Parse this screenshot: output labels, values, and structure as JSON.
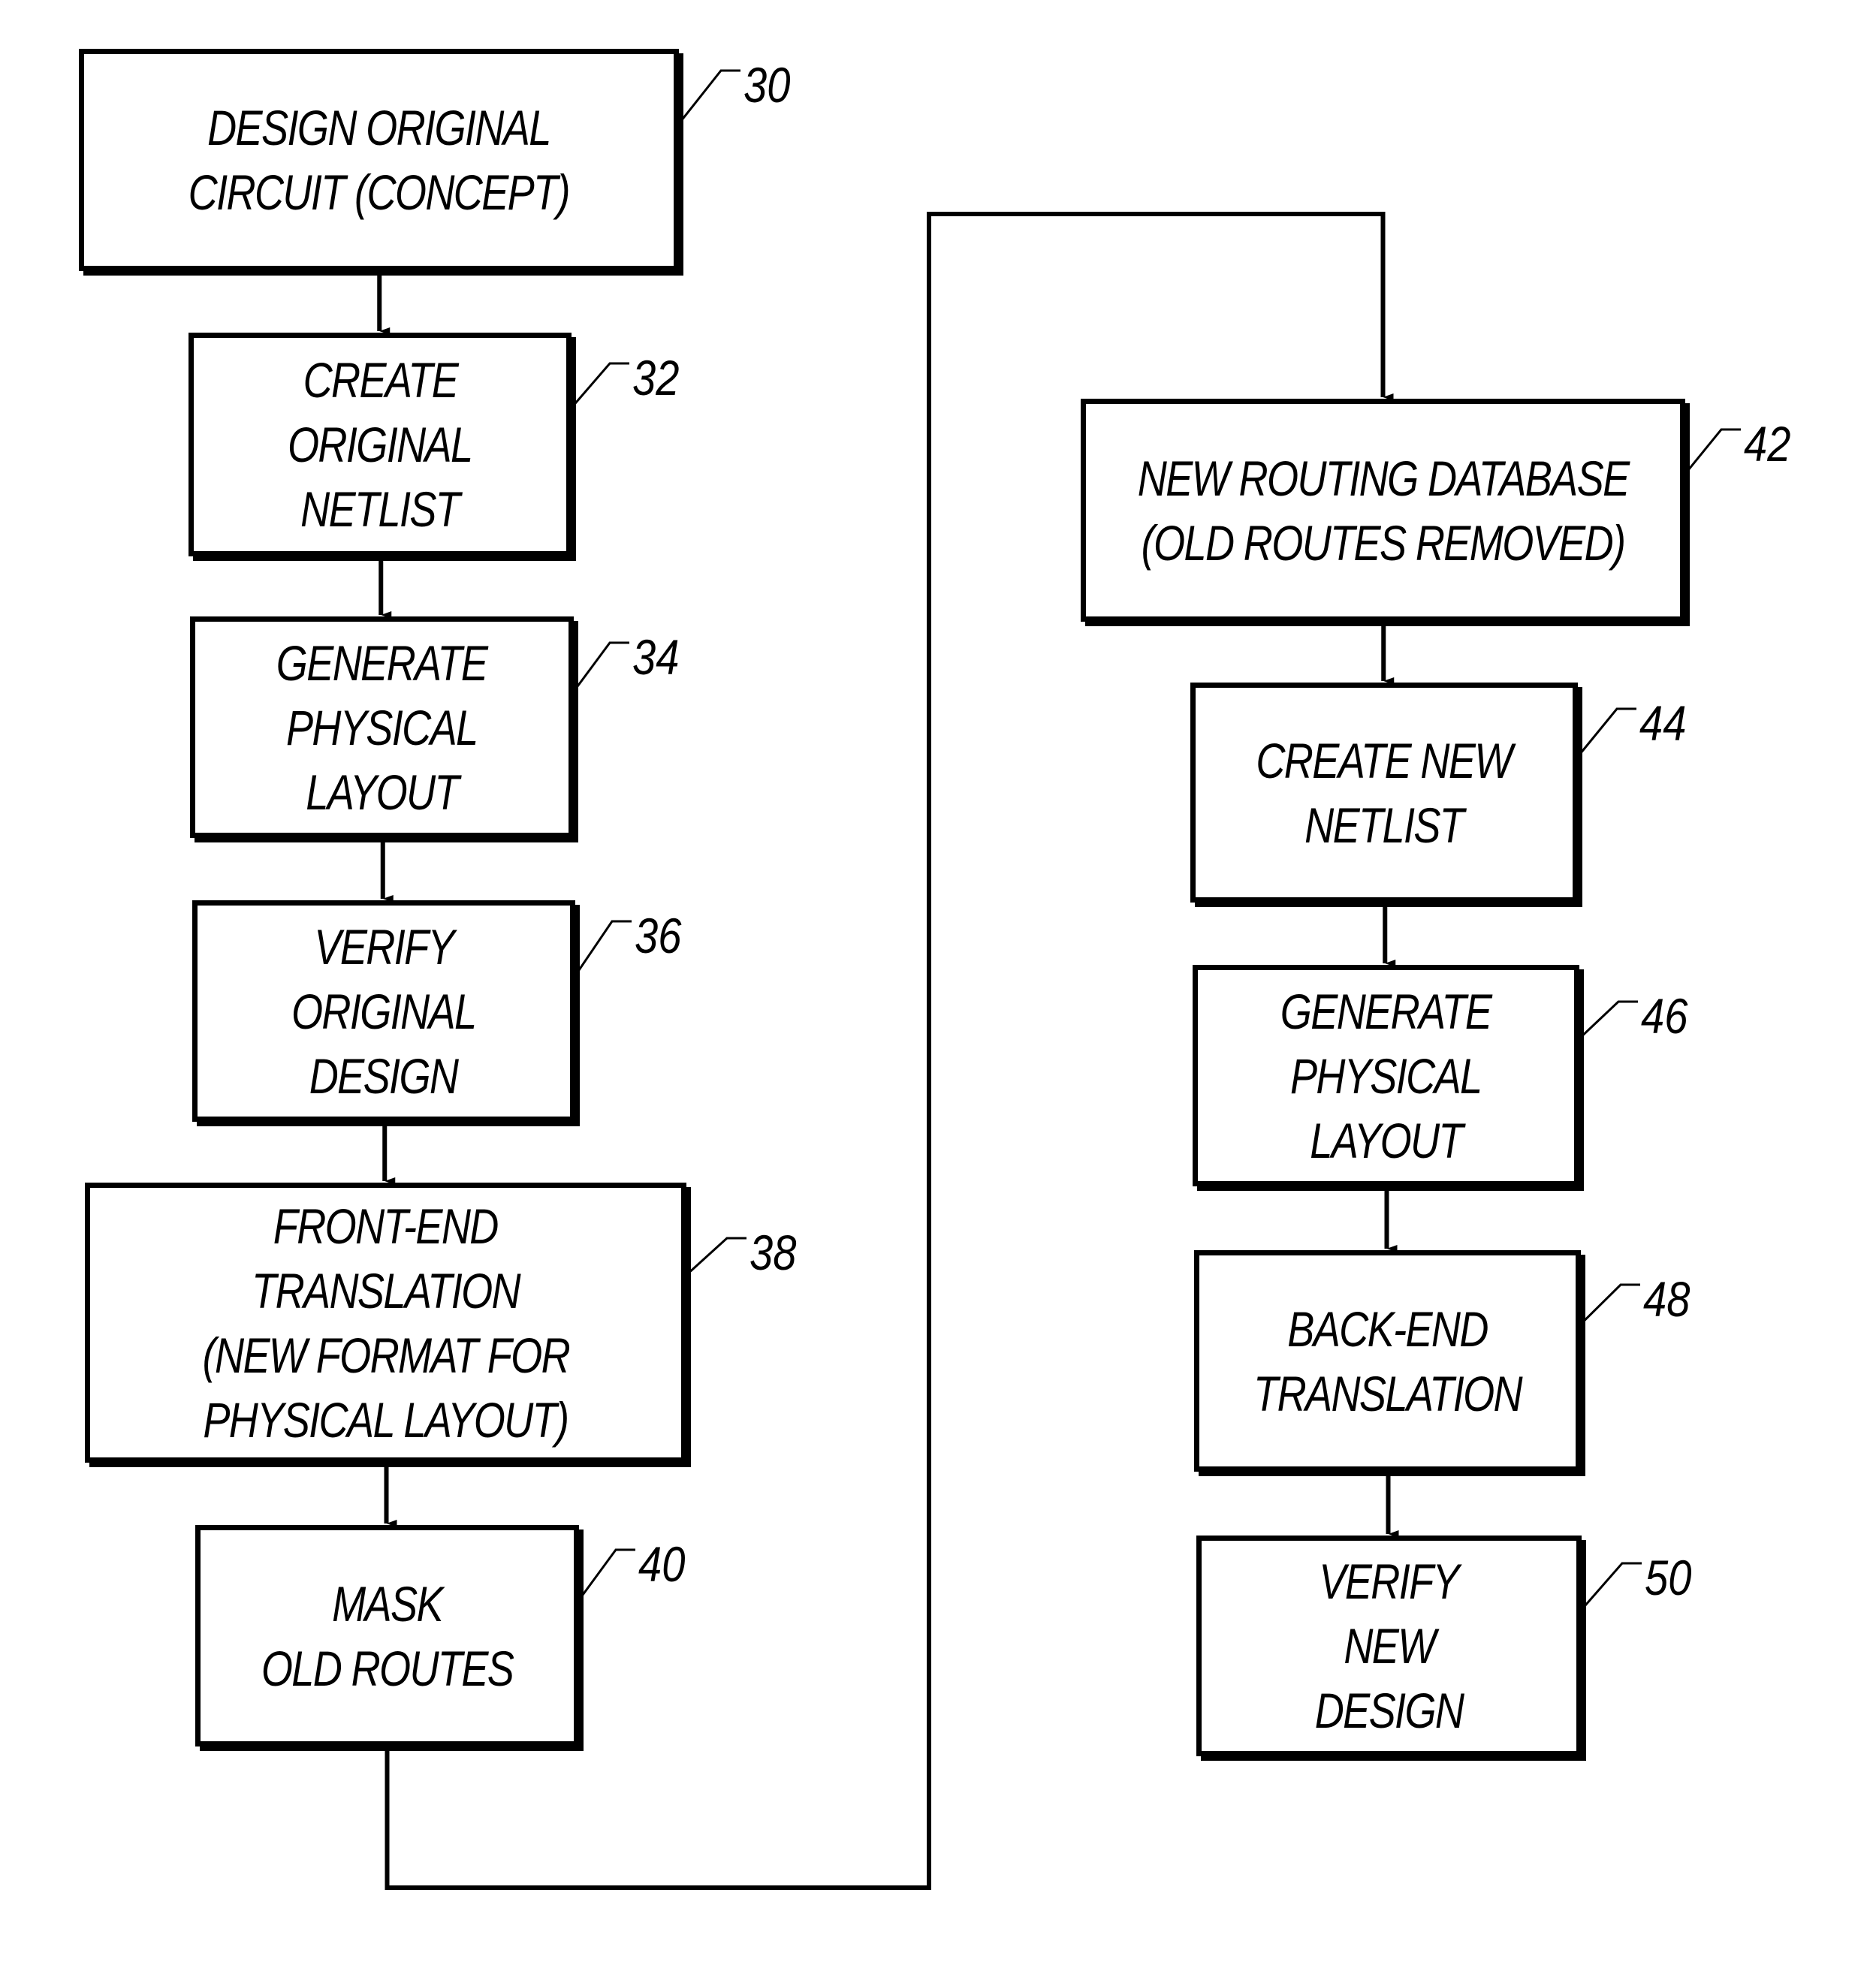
{
  "figure": {
    "nodes": [
      {
        "id": "30",
        "ref": "30",
        "lines": [
          "DESIGN ORIGINAL",
          "CIRCUIT (CONCEPT)"
        ]
      },
      {
        "id": "32",
        "ref": "32",
        "lines": [
          "CREATE",
          "ORIGINAL",
          "NETLIST"
        ]
      },
      {
        "id": "34",
        "ref": "34",
        "lines": [
          "GENERATE",
          "PHYSICAL",
          "LAYOUT"
        ]
      },
      {
        "id": "36",
        "ref": "36",
        "lines": [
          "VERIFY",
          "ORIGINAL",
          "DESIGN"
        ]
      },
      {
        "id": "38",
        "ref": "38",
        "lines": [
          "FRONT-END",
          "TRANSLATION",
          "(NEW FORMAT FOR",
          "PHYSICAL LAYOUT)"
        ]
      },
      {
        "id": "40",
        "ref": "40",
        "lines": [
          "MASK",
          "OLD ROUTES"
        ]
      },
      {
        "id": "42",
        "ref": "42",
        "lines": [
          "NEW ROUTING DATABASE",
          "(OLD ROUTES REMOVED)"
        ]
      },
      {
        "id": "44",
        "ref": "44",
        "lines": [
          "CREATE NEW",
          "NETLIST"
        ]
      },
      {
        "id": "46",
        "ref": "46",
        "lines": [
          "GENERATE",
          "PHYSICAL",
          "LAYOUT"
        ]
      },
      {
        "id": "48",
        "ref": "48",
        "lines": [
          "BACK-END",
          "TRANSLATION"
        ]
      },
      {
        "id": "50",
        "ref": "50",
        "lines": [
          "VERIFY",
          "NEW",
          "DESIGN"
        ]
      }
    ],
    "edges": [
      {
        "from": "30",
        "to": "32"
      },
      {
        "from": "32",
        "to": "34"
      },
      {
        "from": "34",
        "to": "36"
      },
      {
        "from": "36",
        "to": "38"
      },
      {
        "from": "38",
        "to": "40"
      },
      {
        "from": "40",
        "to": "42"
      },
      {
        "from": "42",
        "to": "44"
      },
      {
        "from": "44",
        "to": "46"
      },
      {
        "from": "46",
        "to": "48"
      },
      {
        "from": "48",
        "to": "50"
      }
    ]
  }
}
